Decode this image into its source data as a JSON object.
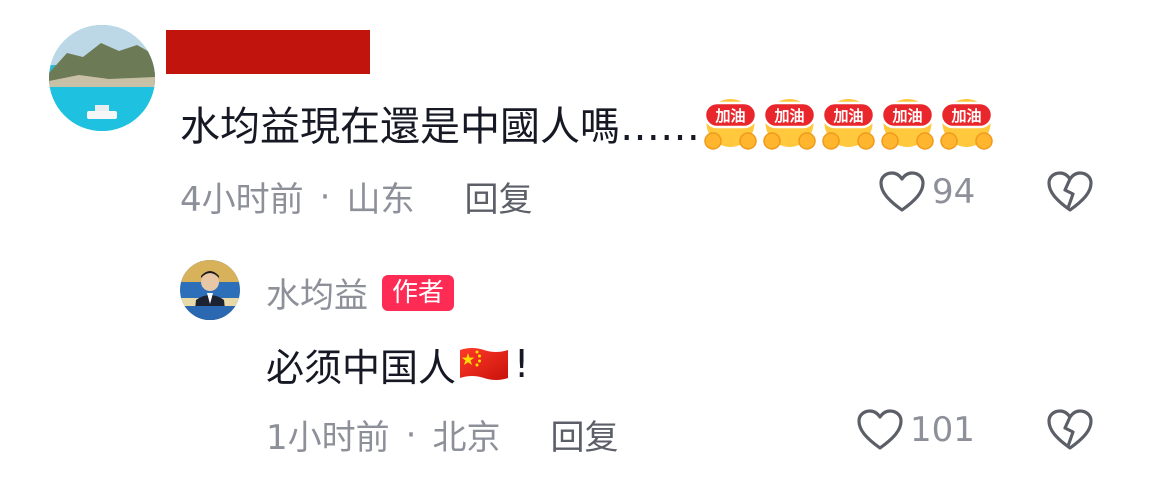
{
  "comment": {
    "text": "水均益現在還是中國人嗎……",
    "emoji_label": "加油",
    "emoji_count": 5,
    "time": "4小时前",
    "separator": "·",
    "location": "山东",
    "reply_label": "回复",
    "likes": "94"
  },
  "reply": {
    "author": "水均益",
    "badge": "作者",
    "text_before": "必须中国人",
    "text_after": "!",
    "time": "1小时前",
    "separator": "·",
    "location": "北京",
    "reply_label": "回复",
    "likes": "101"
  },
  "colors": {
    "redaction": "#c0140c",
    "badge": "#fe2c55",
    "muted": "#8e9099",
    "text": "#161823"
  }
}
